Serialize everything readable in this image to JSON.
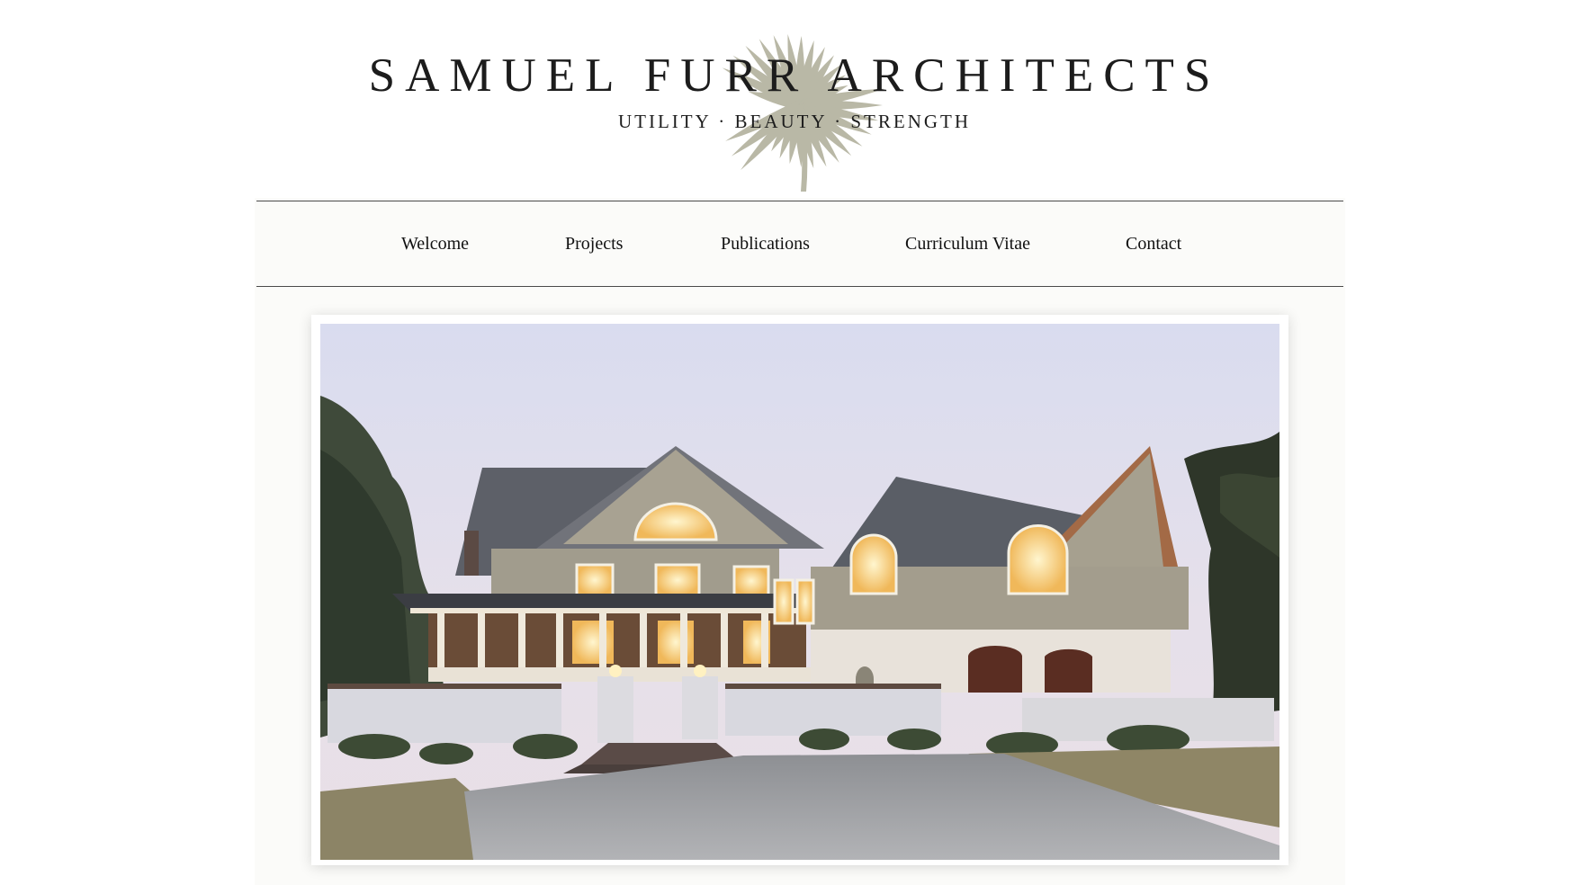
{
  "header": {
    "title": "SAMUEL FURR ARCHITECTS",
    "tagline": "UTILITY · BEAUTY · STRENGTH",
    "logo_icon": "palm-frond-icon",
    "logo_color": "#b9b8a6"
  },
  "nav": {
    "items": [
      {
        "label": "Welcome"
      },
      {
        "label": "Projects"
      },
      {
        "label": "Publications"
      },
      {
        "label": "Curriculum Vitae"
      },
      {
        "label": "Contact"
      }
    ]
  },
  "hero": {
    "image": "house-at-dusk-photo"
  },
  "colors": {
    "page_background": "#ffffff",
    "column_background": "#fbfbf9",
    "rule": "#4a4a4a",
    "text": "#1c1c1c"
  }
}
